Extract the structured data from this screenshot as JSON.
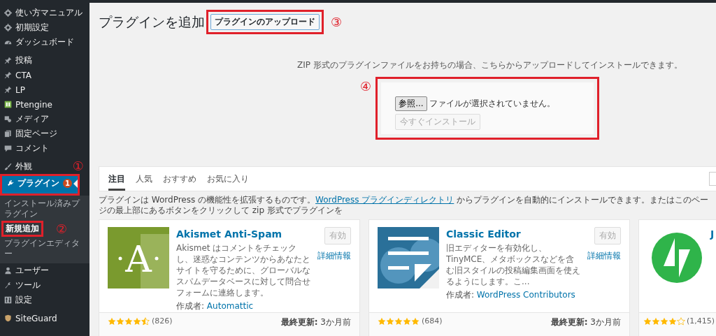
{
  "sidebar": {
    "groups": [
      [
        {
          "label": "使い方マニュアル",
          "kind": "gear",
          "selected": false
        },
        {
          "label": "初期設定",
          "kind": "gear",
          "selected": false
        },
        {
          "label": "ダッシュボード",
          "kind": "gauge",
          "selected": false
        }
      ],
      [
        {
          "label": "投稿",
          "kind": "pin",
          "selected": false
        },
        {
          "label": "CTA",
          "kind": "pin",
          "selected": false
        },
        {
          "label": "LP",
          "kind": "pin",
          "selected": false
        },
        {
          "label": "Ptengine",
          "kind": "ptengine",
          "selected": false
        },
        {
          "label": "メディア",
          "kind": "media",
          "selected": false
        },
        {
          "label": "固定ページ",
          "kind": "pages",
          "selected": false
        },
        {
          "label": "コメント",
          "kind": "comment",
          "selected": false
        }
      ],
      [
        {
          "label": "外観",
          "kind": "brush",
          "selected": false
        },
        {
          "label": "プラグイン",
          "kind": "plug",
          "selected": true,
          "badge": "1",
          "annotation": "①",
          "submenu": [
            {
              "label": "インストール済みプラグイン",
              "selected": false
            },
            {
              "label": "新規追加",
              "selected": true,
              "annotation": "②"
            },
            {
              "label": "プラグインエディター",
              "selected": false
            }
          ]
        },
        {
          "label": "ユーザー",
          "kind": "user",
          "selected": false
        },
        {
          "label": "ツール",
          "kind": "wrench",
          "selected": false
        },
        {
          "label": "設定",
          "kind": "settings",
          "selected": false
        }
      ],
      [
        {
          "label": "SiteGuard",
          "kind": "shield",
          "selected": false
        }
      ]
    ]
  },
  "header": {
    "title": "プラグインを追加",
    "upload_button": "プラグインのアップロード",
    "annotation": "③"
  },
  "upload": {
    "help": "ZIP 形式のプラグインファイルをお持ちの場合、こちらからアップロードしてインストールできます。",
    "annotation": "④",
    "browse_button": "参照...",
    "file_status": "ファイルが選択されていません。",
    "install_button": {
      "label": "今すぐインストール",
      "disabled": true
    }
  },
  "filter_tabs": [
    {
      "label": "注目",
      "selected": true
    },
    {
      "label": "人気",
      "selected": false
    },
    {
      "label": "おすすめ",
      "selected": false
    },
    {
      "label": "お気に入り",
      "selected": false
    }
  ],
  "intro": {
    "text_before": "プラグインは WordPress の機能性を拡張するものです。",
    "link": "WordPress プラグインディレクトリ",
    "text_after": " からプラグインを自動的にインストールできます。またはこのページの最上部にあるボタンをクリックして zip 形式でプラグインを"
  },
  "plugins": [
    {
      "kind": "akismet",
      "logo_text": "A",
      "name": "Akismet Anti-Spam",
      "description": "Akismet はコメントをチェックし、迷惑なコンテンツからあなたとサイトを守るために、グローバルなスパムデータベースに対して問合せフォームに連絡します。",
      "author_label": "作成者:",
      "author": "Automattic",
      "action_button": {
        "label": "有効",
        "disabled": true
      },
      "details_link": "詳細情報",
      "stars": 4.5,
      "rating_count": "(826)",
      "updated_label": "最終更新:",
      "updated": "3か月前"
    },
    {
      "kind": "classic",
      "name": "Classic Editor",
      "description": "旧エディターを有効化し、TinyMCE、メタボックスなどを含む旧スタイルの投稿編集画面を使えるようにします。こ...",
      "author_label": "作成者:",
      "author": "WordPress Contributors",
      "action_button": {
        "label": "有効",
        "disabled": true
      },
      "details_link": "詳細情報",
      "stars": 5,
      "rating_count": "(684)",
      "updated_label": "最終更新:",
      "updated": "3か月前"
    },
    {
      "kind": "bolt",
      "name": "J",
      "stars": 4,
      "rating_count": "(1,415)"
    }
  ]
}
